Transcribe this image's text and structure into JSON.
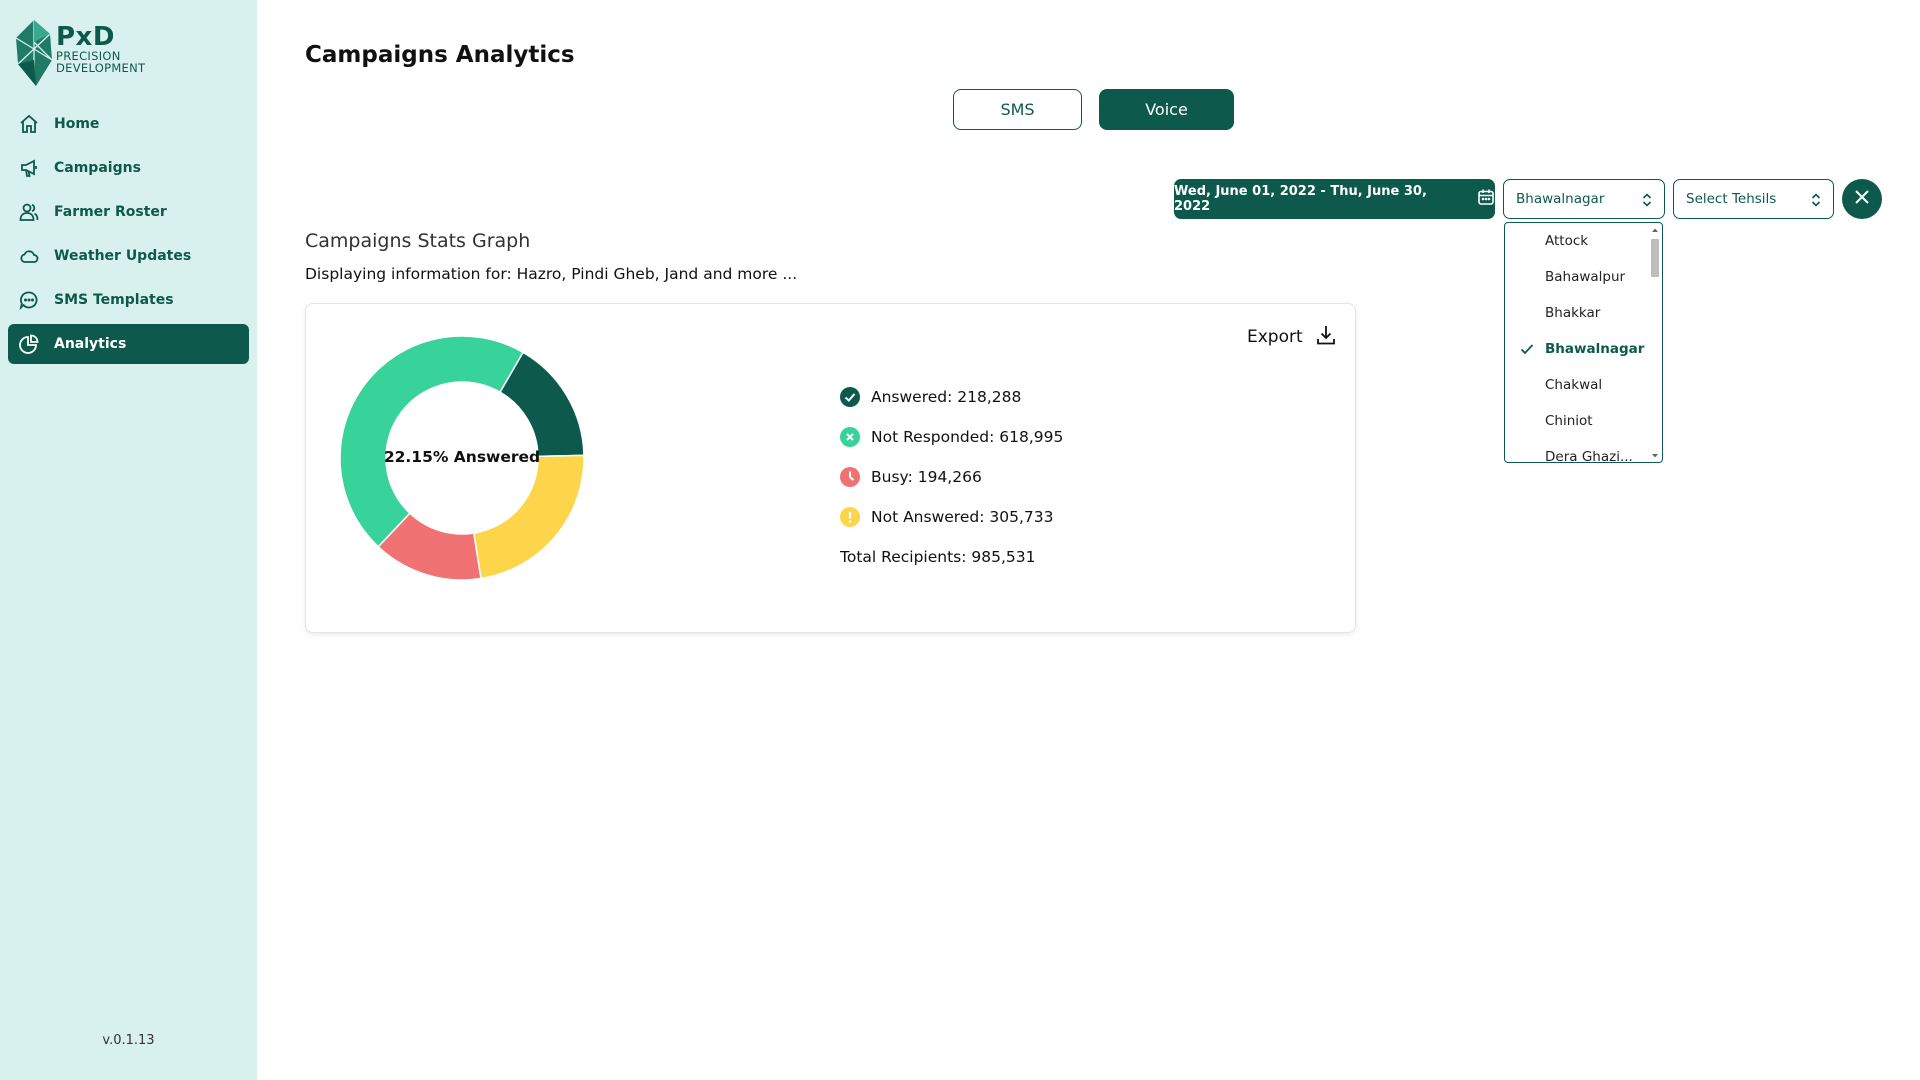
{
  "brand": {
    "name": "PxD",
    "line1": "PRECISION",
    "line2": "DEVELOPMENT",
    "color": "#0d5a4c",
    "sidebar_bg": "#d9f1ee"
  },
  "sidebar": {
    "items": [
      {
        "label": "Home",
        "icon": "home-icon"
      },
      {
        "label": "Campaigns",
        "icon": "megaphone-icon"
      },
      {
        "label": "Farmer Roster",
        "icon": "users-icon"
      },
      {
        "label": "Weather Updates",
        "icon": "cloud-icon"
      },
      {
        "label": "SMS Templates",
        "icon": "chat-icon"
      },
      {
        "label": "Analytics",
        "icon": "pie-chart-icon",
        "active": true
      }
    ],
    "version": "v.0.1.13"
  },
  "header": {
    "title": "Campaigns Analytics"
  },
  "tabs": {
    "sms": "SMS",
    "voice": "Voice",
    "active": "Voice"
  },
  "filters": {
    "date_range": "Wed, June 01, 2022 - Thu, June 30, 2022",
    "district_selected": "Bhawalnagar",
    "tehsil_placeholder": "Select Tehsils",
    "district_options": [
      "Attock",
      "Bahawalpur",
      "Bhakkar",
      "Bhawalnagar",
      "Chakwal",
      "Chiniot",
      "Dera Ghazi..."
    ]
  },
  "stats": {
    "section_title": "Campaigns Stats Graph",
    "subtitle": "Displaying information for: Hazro, Pindi Gheb, Jand and more ...",
    "export_label": "Export",
    "center_label": "22.15% Answered",
    "legend": {
      "answered": "Answered: 218,288",
      "not_responded": "Not Responded: 618,995",
      "busy": "Busy: 194,266",
      "not_answered": "Not Answered: 305,733",
      "total": "Total Recipients: 985,531"
    },
    "colors": {
      "answered": "#0d5a4c",
      "not_responded": "#38d39a",
      "busy": "#f07272",
      "not_answered": "#fdd54b"
    }
  },
  "chart_data": {
    "type": "pie",
    "categories": [
      "Answered",
      "Not Responded",
      "Busy",
      "Not Answered"
    ],
    "values": [
      218288,
      618995,
      194266,
      305733
    ],
    "colors": [
      "#0d5a4c",
      "#38d39a",
      "#f07272",
      "#fdd54b"
    ]
  }
}
